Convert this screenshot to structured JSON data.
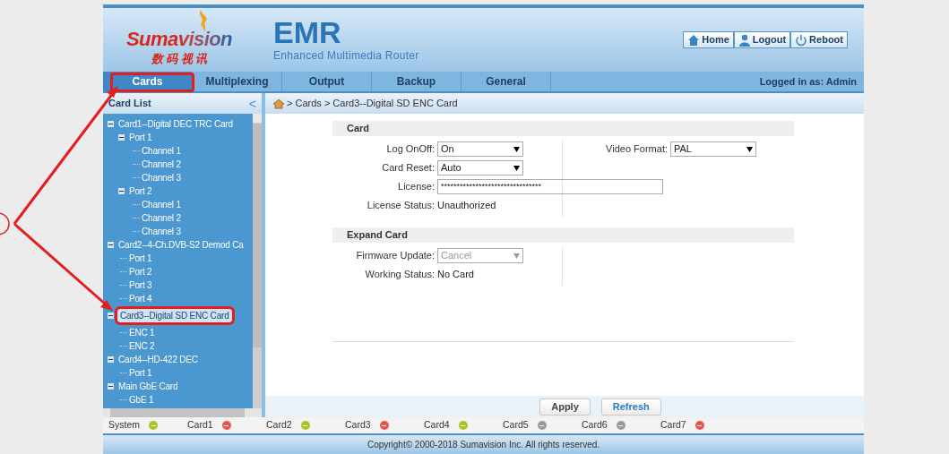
{
  "header": {
    "logo": {
      "text": "Sumavision",
      "chinese": "数 码 视 讯"
    },
    "product": {
      "title": "EMR",
      "subtitle": "Enhanced Multimedia Router"
    },
    "buttons": [
      {
        "kind": "home",
        "label": "Home"
      },
      {
        "kind": "user",
        "label": "Logout"
      },
      {
        "kind": "power",
        "label": "Reboot"
      }
    ]
  },
  "tabs": [
    {
      "label": "Cards",
      "selected": true
    },
    {
      "label": "Multiplexing",
      "selected": false
    },
    {
      "label": "Output",
      "selected": false
    },
    {
      "label": "Backup",
      "selected": false
    },
    {
      "label": "General",
      "selected": false
    }
  ],
  "login_status": "Logged in as: Admin",
  "sidebar": {
    "title": "Card List",
    "collapse": "<",
    "tree": [
      {
        "label": "Card1--Digital DEC TRC Card",
        "selected": false,
        "expanded": true,
        "children": [
          {
            "label": "Port 1",
            "selected": false,
            "expanded": true,
            "children": [
              {
                "label": "Channel 1",
                "selected": false
              },
              {
                "label": "Channel 2",
                "selected": false
              },
              {
                "label": "Channel 3",
                "selected": false
              }
            ]
          },
          {
            "label": "Port 2",
            "selected": false,
            "expanded": true,
            "children": [
              {
                "label": "Channel 1",
                "selected": false
              },
              {
                "label": "Channel 2",
                "selected": false
              },
              {
                "label": "Channel 3",
                "selected": false
              }
            ]
          }
        ]
      },
      {
        "label": "Card2--4-Ch.DVB-S2 Demod Ca",
        "selected": false,
        "expanded": true,
        "children": [
          {
            "label": "Port 1",
            "selected": false
          },
          {
            "label": "Port 2",
            "selected": false
          },
          {
            "label": "Port 3",
            "selected": false
          },
          {
            "label": "Port 4",
            "selected": false
          }
        ]
      },
      {
        "label": "Card3--Digital SD ENC Card",
        "selected": true,
        "expanded": true,
        "children": [
          {
            "label": "ENC 1",
            "selected": false
          },
          {
            "label": "ENC 2",
            "selected": false
          }
        ]
      },
      {
        "label": "Card4--HD-422 DEC",
        "selected": false,
        "expanded": true,
        "children": [
          {
            "label": "Port 1",
            "selected": false
          }
        ]
      },
      {
        "label": "Main GbE Card",
        "selected": false,
        "expanded": true,
        "children": [
          {
            "label": "GbE 1",
            "selected": false
          }
        ]
      }
    ]
  },
  "breadcrumb": "> Cards > Card3--Digital SD ENC Card",
  "sections": [
    {
      "title": "Card",
      "left": [
        {
          "kind": "select",
          "label": "Log OnOff:",
          "value": "On",
          "disabled": false
        },
        {
          "kind": "select",
          "label": "Card Reset:",
          "value": "Auto",
          "disabled": false
        },
        {
          "kind": "input",
          "label": "License:",
          "value": "********************************"
        },
        {
          "kind": "text",
          "label": "License Status:",
          "value": "Unauthorized"
        }
      ],
      "right": [
        {
          "kind": "select",
          "label": "Video Format:",
          "value": "PAL",
          "disabled": false
        }
      ]
    },
    {
      "title": "Expand Card",
      "left": [
        {
          "kind": "select",
          "label": "Firmware Update:",
          "value": "Cancel",
          "disabled": true
        },
        {
          "kind": "text",
          "label": "Working Status:",
          "value": "No Card"
        }
      ]
    }
  ],
  "actions": [
    "Apply",
    "Refresh"
  ],
  "status_bar": [
    {
      "label": "System",
      "color": "#a9c41e"
    },
    {
      "label": "Card1",
      "color": "#e8574f"
    },
    {
      "label": "Card2",
      "color": "#a9c41e"
    },
    {
      "label": "Card3",
      "color": "#e8574f"
    },
    {
      "label": "Card4",
      "color": "#a9c41e"
    },
    {
      "label": "Card5",
      "color": "#9a9a9a"
    },
    {
      "label": "Card6",
      "color": "#9a9a9a"
    },
    {
      "label": "Card7",
      "color": "#e8574f"
    }
  ],
  "footer": "Copyright© 2000-2018 Sumavision Inc. All rights reserved."
}
